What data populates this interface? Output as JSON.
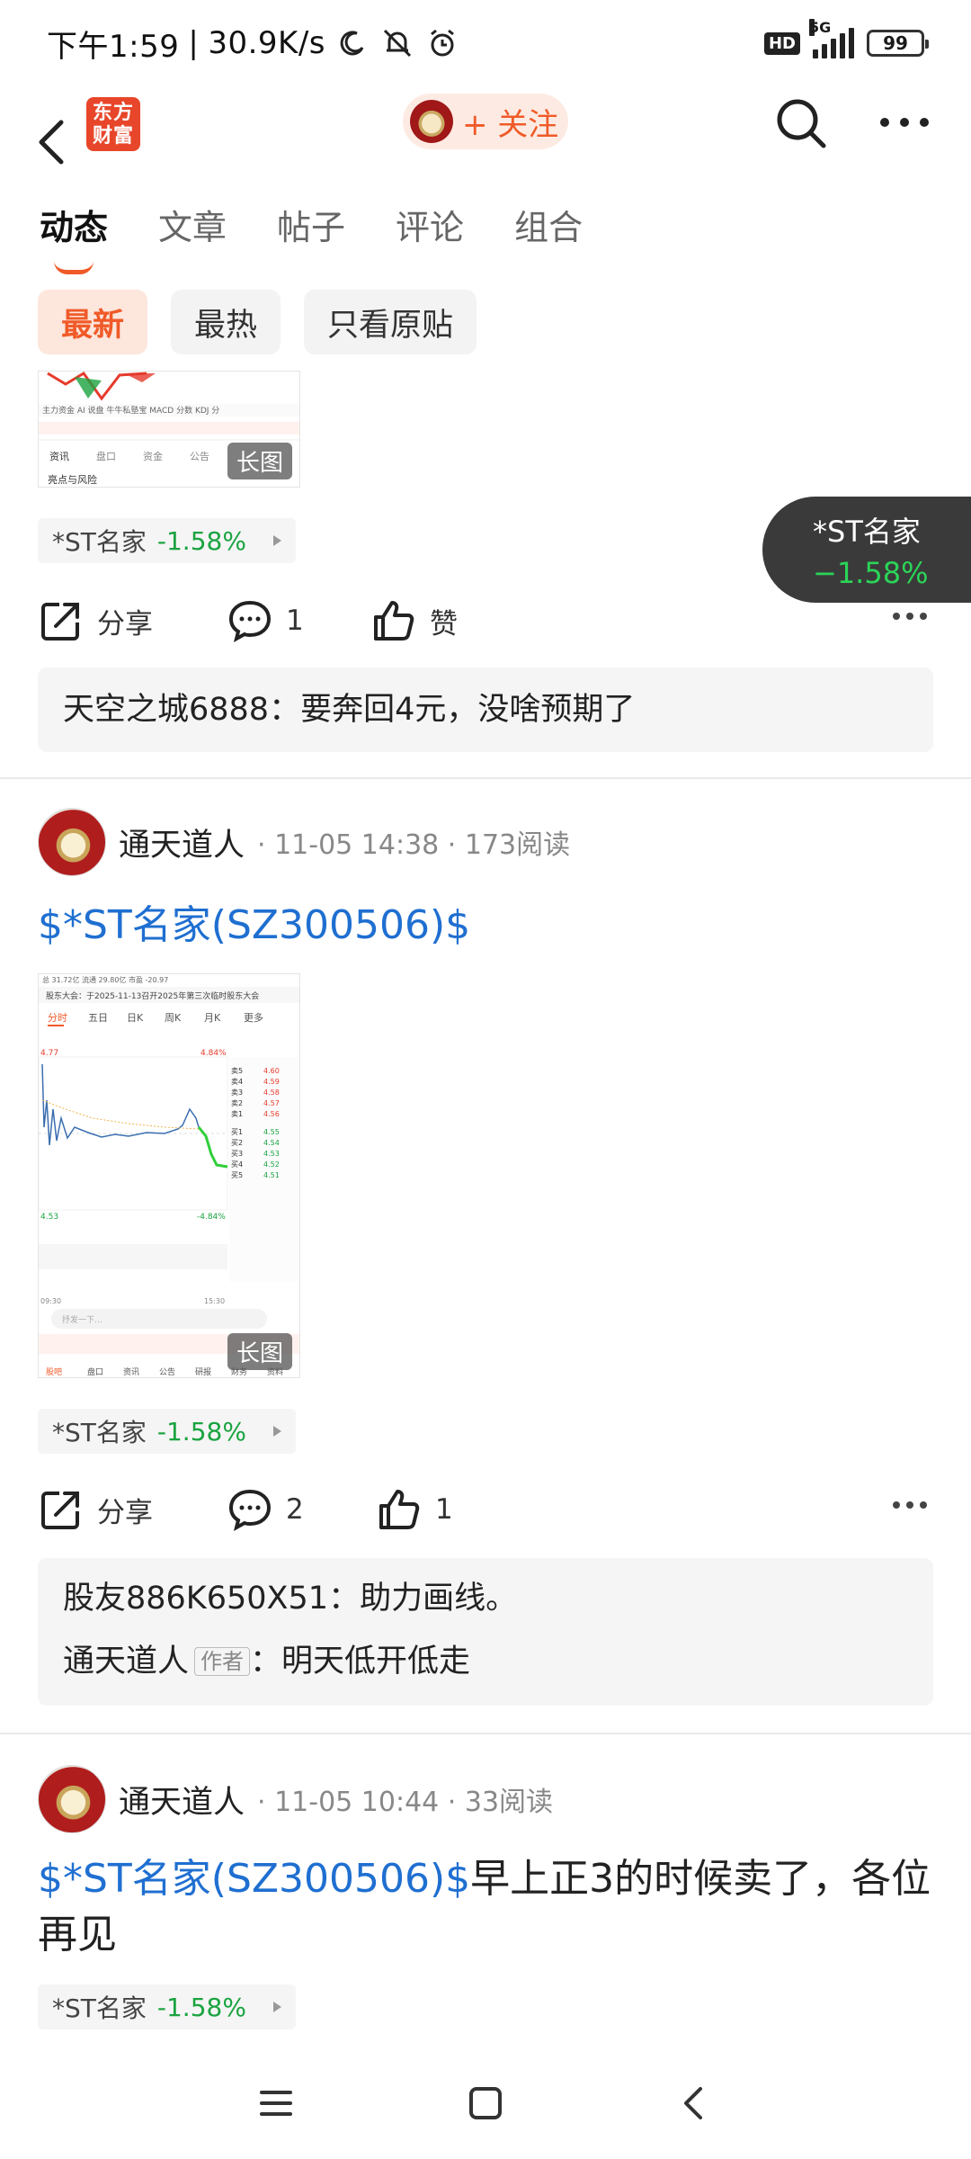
{
  "status_bar": {
    "time": "下午1:59",
    "speed": "30.9K/s",
    "network": "5G",
    "battery": "99",
    "hd": "HD"
  },
  "header": {
    "logo_line1": "东方",
    "logo_line2": "财富",
    "follow_label": "+ 关注"
  },
  "tabs": [
    "动态",
    "文章",
    "帖子",
    "评论",
    "组合"
  ],
  "filters": [
    "最新",
    "最热",
    "只看原贴"
  ],
  "floating_quote": {
    "name": "*ST名家",
    "change": "−1.58%"
  },
  "post1": {
    "long_tag": "长图",
    "stock": {
      "name": "*ST名家",
      "change": "-1.58%"
    },
    "share": "分享",
    "comments": "1",
    "like": "赞",
    "comment_user": "天空之城6888",
    "comment_text": "要奔回4元，没啥预期了"
  },
  "post2": {
    "author": "通天道人",
    "meta": "· 11-05 14:38 · 173阅读",
    "title_link": "$*ST名家(SZ300506)$",
    "long_tag": "长图",
    "stock": {
      "name": "*ST名家",
      "change": "-1.58%"
    },
    "share": "分享",
    "comments": "2",
    "likes": "1",
    "comment1_user": "股友886K650X51",
    "comment1_text": "助力画线。",
    "comment2_user": "通天道人",
    "comment2_tag": "作者",
    "comment2_text": "明天低开低走"
  },
  "post3": {
    "author": "通天道人",
    "meta": "· 11-05 10:44 · 33阅读",
    "title_link": "$*ST名家(SZ300506)$",
    "title_rest": "早上正3的时候卖了，各位再见",
    "stock": {
      "name": "*ST名家",
      "change": "-1.58%"
    }
  },
  "thumb2_text": {
    "top": "总 31.72亿  流通 29.80亿  市盈 -20.97",
    "notice": "股东大会：于2025-11-13召开2025年第三次临时股东大会",
    "periods": [
      "分时",
      "五日",
      "日K",
      "周K",
      "月K",
      "更多"
    ],
    "price_hi": "4.77",
    "price_lo": "4.53",
    "pct_hi": "4.84%",
    "pct_lo": "-4.84%",
    "time_start": "09:30",
    "time_end": "15:30",
    "input_placeholder": "抒发一下…",
    "bottom_tabs": [
      "股吧",
      "盘口",
      "资讯",
      "公告",
      "研报",
      "财务",
      "资料"
    ]
  },
  "thumb1_text": {
    "tabs": [
      "资讯",
      "盘口",
      "资金",
      "公告"
    ],
    "risk": "亮点与风险",
    "tools": "主力资金  AI 说盘  牛牛私塾宝  MACD 分数  KDJ 分"
  },
  "colors": {
    "accent": "#f05a28",
    "link": "#1f6fd1",
    "down": "#1aa340"
  },
  "icons": [
    "back-icon",
    "search-icon",
    "more-icon",
    "share-icon",
    "comment-icon",
    "like-icon",
    "menu-icon",
    "home-icon"
  ]
}
